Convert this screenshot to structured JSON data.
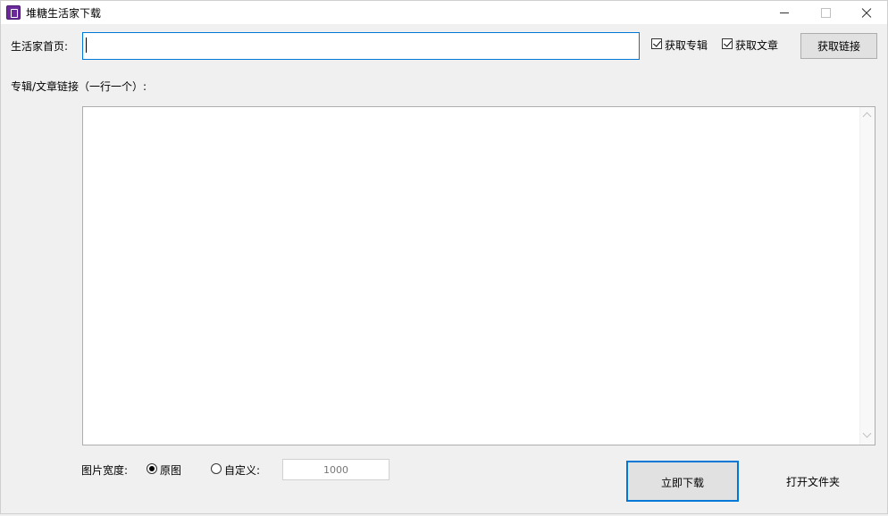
{
  "window": {
    "title": "堆糖生活家下载",
    "controls": [
      "minimize",
      "maximize",
      "close"
    ]
  },
  "home": {
    "label": "生活家首页:",
    "value": ""
  },
  "options": {
    "album_label": "获取专辑",
    "album_checked": true,
    "article_label": "获取文章",
    "article_checked": true
  },
  "fetch_button": "获取链接",
  "links": {
    "label": "专辑/文章链接（一行一个）:",
    "value": ""
  },
  "image_width": {
    "label": "图片宽度:",
    "original_label": "原图",
    "original_selected": true,
    "custom_label": "自定义:",
    "custom_value": "1000"
  },
  "actions": {
    "download": "立即下载",
    "open_folder": "打开文件夹"
  },
  "colors": {
    "accent": "#0078d7",
    "background": "#f0f0f0",
    "button": "#e1e1e1"
  }
}
